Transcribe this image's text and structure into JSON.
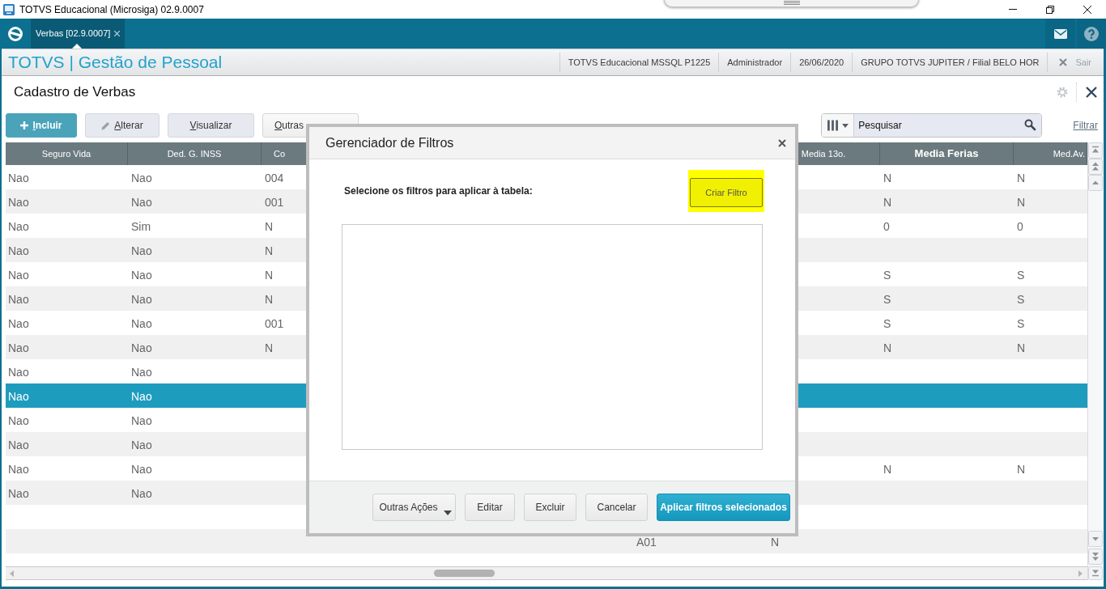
{
  "window": {
    "title": "TOTVS Educacional (Microsiga) 02.9.0007"
  },
  "tabs": [
    {
      "label": "Verbas [02.9.0007]",
      "selected": true
    }
  ],
  "header": {
    "brand": "TOTVS | Gestão de Pessoal",
    "info": [
      "TOTVS Educacional MSSQL P1225",
      "Administrador",
      "26/06/2020",
      "GRUPO TOTVS JUPITER / Filial BELO HOR"
    ],
    "exit": "Sair"
  },
  "page": {
    "title": "Cadastro de Verbas"
  },
  "toolbar": [
    {
      "label": "Incluir",
      "kind": "primary"
    },
    {
      "label": "Alterar",
      "kind": "edit"
    },
    {
      "label": "Visualizar",
      "kind": "plain"
    },
    {
      "label": "Outras",
      "kind": "menu"
    }
  ],
  "search": {
    "placeholder": "Pesquisar",
    "filter_link": "Filtrar"
  },
  "table": {
    "columns": [
      {
        "label": "Seguro Vida",
        "sorted": false
      },
      {
        "label": "Ded. G. INSS",
        "sorted": false
      },
      {
        "label": "Co",
        "sorted": false
      },
      null,
      null,
      {
        "label": "Media 13o.",
        "sorted": false
      },
      {
        "label": "Media Ferias",
        "sorted": true
      },
      {
        "label": "Med.Av.",
        "sorted": false
      }
    ],
    "rows": [
      {
        "cells": [
          "Nao",
          "Nao",
          "004",
          null,
          null,
          null,
          "N",
          "N"
        ],
        "selected": false
      },
      {
        "cells": [
          "Nao",
          "Nao",
          "001",
          null,
          null,
          null,
          "N",
          "N"
        ],
        "selected": false
      },
      {
        "cells": [
          "Nao",
          "Sim",
          "N",
          null,
          null,
          null,
          "0",
          "0"
        ],
        "selected": false
      },
      {
        "cells": [
          "Nao",
          "Nao",
          "N",
          null,
          null,
          null,
          null,
          null
        ],
        "selected": false
      },
      {
        "cells": [
          "Nao",
          "Nao",
          "N",
          null,
          null,
          null,
          "S",
          "S"
        ],
        "selected": false
      },
      {
        "cells": [
          "Nao",
          "Nao",
          "N",
          null,
          null,
          null,
          "S",
          "S"
        ],
        "selected": false
      },
      {
        "cells": [
          "Nao",
          "Nao",
          "001",
          null,
          null,
          null,
          "S",
          "S"
        ],
        "selected": false
      },
      {
        "cells": [
          "Nao",
          "Nao",
          "N",
          null,
          null,
          null,
          "N",
          "N"
        ],
        "selected": false
      },
      {
        "cells": [
          "Nao",
          "Nao",
          null,
          null,
          null,
          null,
          null,
          null
        ],
        "selected": false
      },
      {
        "cells": [
          "Nao",
          "Nao",
          null,
          null,
          null,
          null,
          null,
          null
        ],
        "selected": true
      },
      {
        "cells": [
          "Nao",
          "Nao",
          null,
          null,
          null,
          null,
          null,
          null
        ],
        "selected": false
      },
      {
        "cells": [
          "Nao",
          "Nao",
          null,
          null,
          null,
          null,
          null,
          null
        ],
        "selected": false
      },
      {
        "cells": [
          "Nao",
          "Nao",
          null,
          null,
          null,
          null,
          "N",
          "N"
        ],
        "selected": false
      },
      {
        "cells": [
          "Nao",
          "Nao",
          null,
          null,
          null,
          null,
          null,
          null
        ],
        "selected": false
      },
      {
        "cells": [
          null,
          null,
          null,
          null,
          null,
          null,
          null,
          null
        ],
        "selected": false
      },
      {
        "cells": [
          null,
          null,
          null,
          null,
          "A01",
          "N",
          null,
          null
        ],
        "selected": false
      }
    ]
  },
  "dialog": {
    "title": "Gerenciador de Filtros",
    "prompt": "Selecione os filtros para aplicar à tabela:",
    "create_button": {
      "label": "Criar Filtro",
      "highlighted": true
    },
    "buttons": [
      {
        "label": "Outras Ações",
        "kind": "menu"
      },
      {
        "label": "Editar",
        "kind": "plain"
      },
      {
        "label": "Excluir",
        "kind": "plain"
      },
      {
        "label": "Cancelar",
        "kind": "plain"
      },
      {
        "label": "Aplicar filtros selecionados",
        "kind": "primary"
      }
    ]
  }
}
